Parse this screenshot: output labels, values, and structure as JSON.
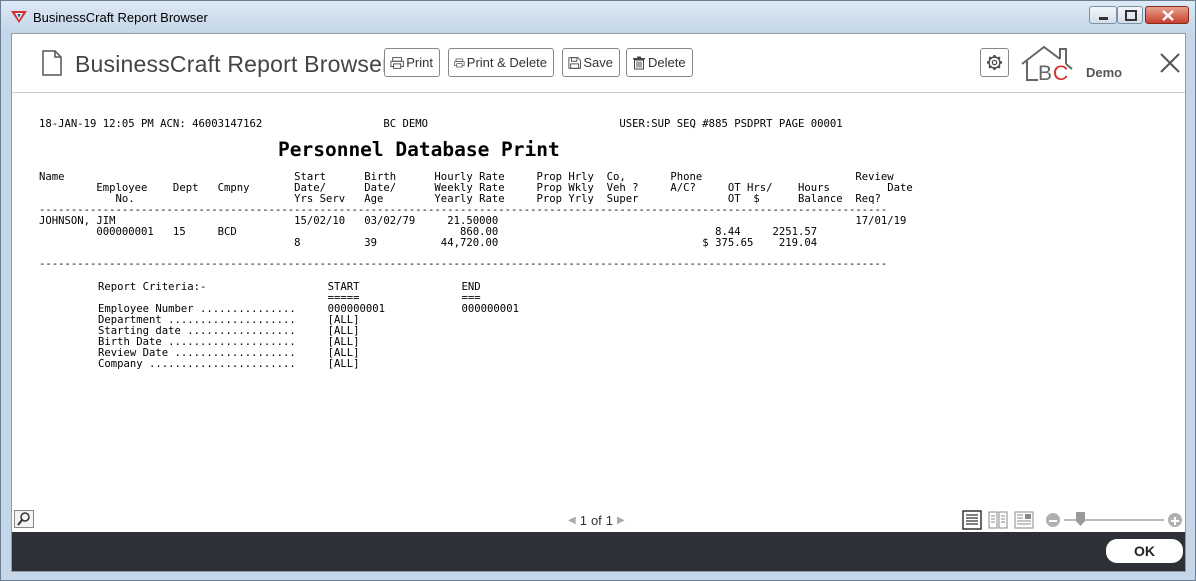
{
  "window": {
    "title": "BusinessCraft Report Browser"
  },
  "header": {
    "app_title": "BusinessCraft Report Browser",
    "buttons": {
      "print": "Print",
      "print_delete": "Print & Delete",
      "save": "Save",
      "delete": "Delete"
    },
    "logo_text": "BC",
    "brand_label": "Demo"
  },
  "report": {
    "header_line": "18-JAN-19 12:05 PM ACN: 46003147162                   BC DEMO                              USER:SUP SEQ #885 PSDPRT PAGE 00001",
    "title": "Personnel Database Print",
    "col_head_1": "Name                                    Start      Birth      Hourly Rate     Prop Hrly  Co,       Phone                        Review",
    "col_head_2": "         Employee    Dept   Cmpny       Date/      Date/      Weekly Rate     Prop Wkly  Veh ?     A/C?     OT Hrs/    Hours         Date",
    "col_head_3": "            No.                         Yrs Serv   Age        Yearly Rate     Prop Yrly  Super              OT  $      Balance  Req?",
    "divider": "-------------------------------------------------------------------------------------------------------------------------------------",
    "row_1": "JOHNSON, JIM                            15/02/10   03/02/79     21.50000                                                        17/01/19",
    "row_2": "         000000001   15     BCD                                   860.00                                  8.44     2251.57",
    "row_3": "                                        8          39          44,720.00                                $ 375.65    219.04",
    "divider2": "-------------------------------------------------------------------------------------------------------------------------------------",
    "criteria": [
      "Report Criteria:-                   START                END",
      "                                    =====                ===",
      "Employee Number ...............     000000001            000000001",
      "Department ....................     [ALL]",
      "Starting date .................     [ALL]",
      "Birth Date ....................     [ALL]",
      "Review Date ...................     [ALL]",
      "Company .......................     [ALL]"
    ]
  },
  "footer": {
    "page_current": "1",
    "page_of": "of",
    "page_total": "1"
  },
  "bottom": {
    "ok_label": "OK"
  },
  "colors": {
    "bottom_bar": "#2d3137",
    "logo_red": "#d0312d",
    "logo_gray": "#666666"
  }
}
